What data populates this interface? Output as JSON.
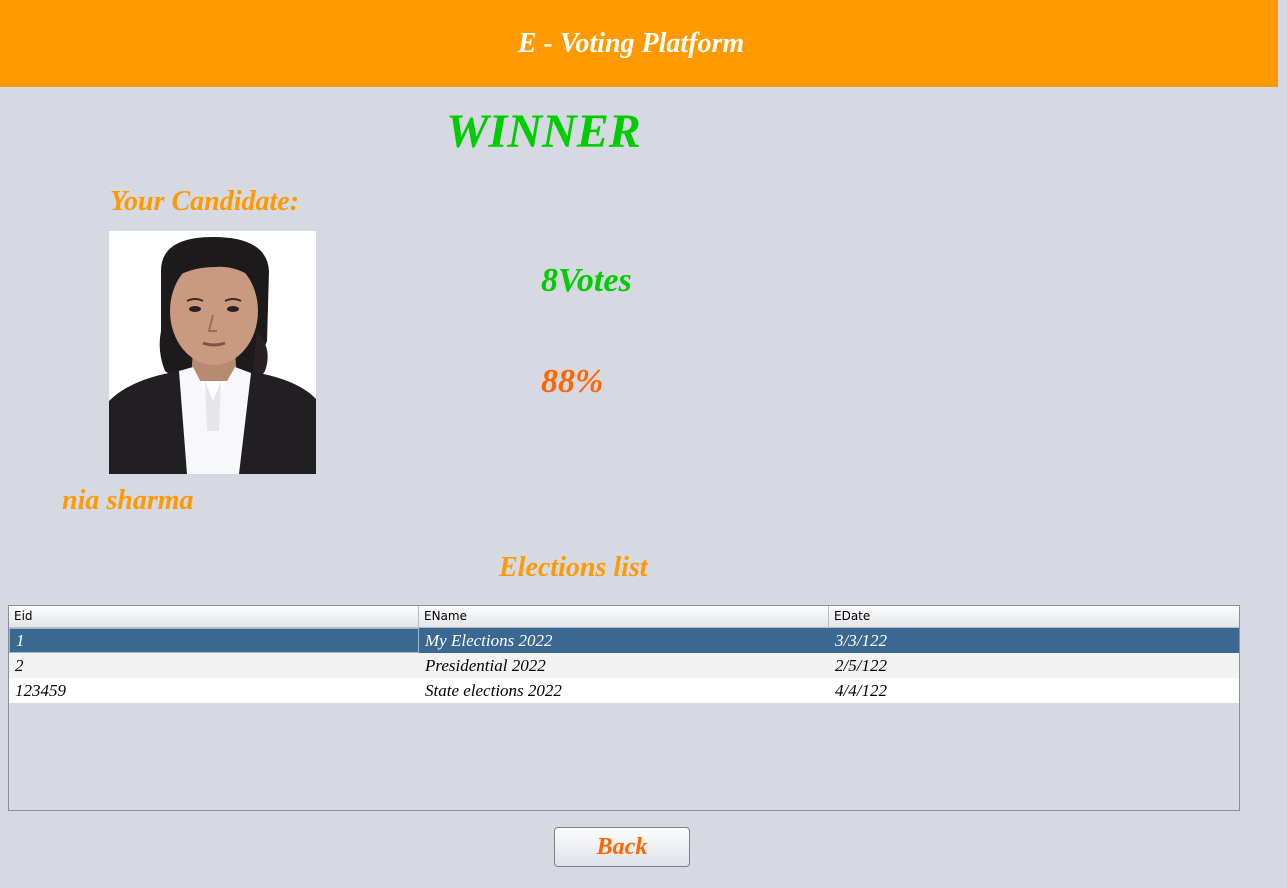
{
  "header": {
    "title": "E - Voting Platform",
    "bg_color": "#ff9900"
  },
  "result": {
    "heading": "WINNER",
    "candidate_label": "Your Candidate:",
    "votes_text": "8Votes",
    "percent_text": "88%",
    "candidate_name": "nia sharma"
  },
  "elections": {
    "title": "Elections list",
    "columns": [
      "Eid",
      "EName",
      "EDate"
    ],
    "rows": [
      [
        "1",
        "My Elections 2022",
        "3/3/122"
      ],
      [
        "2",
        "Presidential 2022",
        "2/5/122"
      ],
      [
        "123459",
        "State elections 2022",
        "4/4/122"
      ]
    ],
    "selected_row": 0
  },
  "actions": {
    "back_label": "Back"
  },
  "colors": {
    "winner_green": "#00cc00",
    "accent_orange": "#ff9900",
    "percent_orange": "#ff6600",
    "selected_row": "#3a6891"
  }
}
